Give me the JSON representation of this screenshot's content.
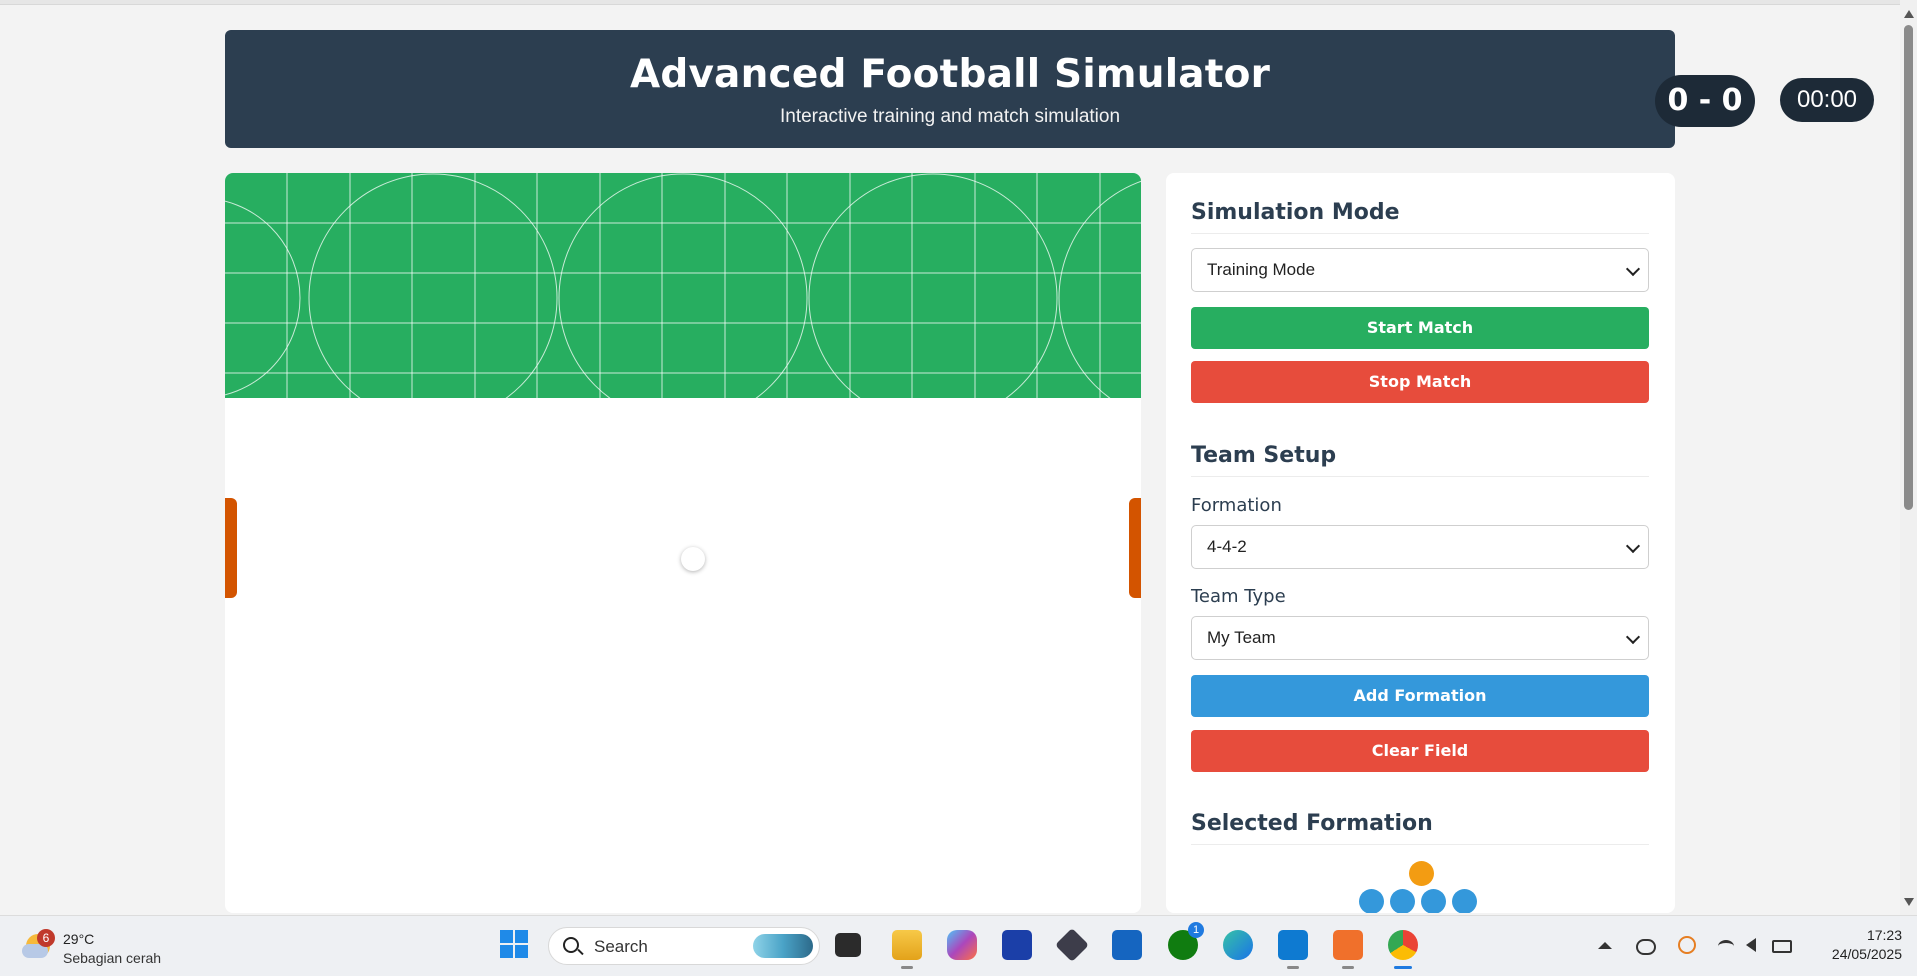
{
  "header": {
    "title": "Advanced Football Simulator",
    "subtitle": "Interactive training and match simulation",
    "score": "0 - 0",
    "clock": "00:00"
  },
  "panel": {
    "simulation": {
      "heading": "Simulation Mode",
      "mode_selected": "Training Mode",
      "start_label": "Start Match",
      "stop_label": "Stop Match"
    },
    "team_setup": {
      "heading": "Team Setup",
      "formation_label": "Formation",
      "formation_selected": "4-4-2",
      "team_type_label": "Team Type",
      "team_type_selected": "My Team",
      "add_label": "Add Formation",
      "clear_label": "Clear Field"
    },
    "selected_formation": {
      "heading": "Selected Formation"
    }
  },
  "colors": {
    "header_bg": "#2c3e50",
    "pitch_green": "#27ae60",
    "goal_orange": "#d35400",
    "start_green": "#27ae60",
    "stop_red": "#e74c3c",
    "add_blue": "#3498db",
    "goalkeeper": "#f39c12",
    "defender": "#3498db"
  },
  "taskbar": {
    "weather_alerts": "6",
    "weather_temp": "29°C",
    "weather_desc": "Sebagian cerah",
    "search_placeholder": "Search",
    "store_badge": "1",
    "time": "17:23",
    "date": "24/05/2025",
    "icons": [
      "windows-start-icon",
      "search-icon",
      "task-view-icon",
      "file-explorer-icon",
      "copilot-icon",
      "vscode-insiders-icon",
      "obsidian-icon",
      "microsoft-store-icon",
      "xbox-icon",
      "edge-icon",
      "vscode-icon",
      "xampp-icon",
      "chrome-icon"
    ]
  }
}
